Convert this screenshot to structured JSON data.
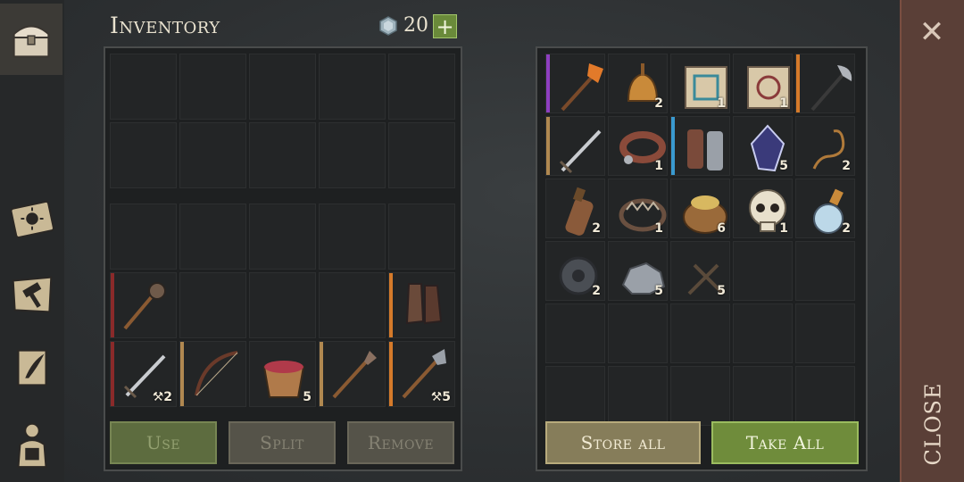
{
  "inventory": {
    "title": "Inventory",
    "gems": "20",
    "add_symbol": "+"
  },
  "inventory_slots": [
    {
      "icon": "mace-icon",
      "qty": "",
      "bar": "#8a2a2a"
    },
    {
      "icon": "",
      "qty": "",
      "bar": ""
    },
    {
      "icon": "",
      "qty": "",
      "bar": ""
    },
    {
      "icon": "",
      "qty": "",
      "bar": ""
    },
    {
      "icon": "boots-icon",
      "qty": "",
      "bar": "#d57a2a"
    },
    {
      "icon": "sword-icon",
      "qty": "2",
      "bar": "#8a2a2a",
      "tool": true
    },
    {
      "icon": "bow-icon",
      "qty": "",
      "bar": "#b08850"
    },
    {
      "icon": "berry-bowl-icon",
      "qty": "5",
      "bar": ""
    },
    {
      "icon": "spear-icon",
      "qty": "",
      "bar": "#b08850"
    },
    {
      "icon": "halberd-icon",
      "qty": "5",
      "bar": "#d57a2a",
      "tool": true
    }
  ],
  "actions": {
    "use": "Use",
    "split": "Split",
    "remove": "Remove"
  },
  "storage_slots": [
    {
      "icon": "fire-axe-icon",
      "qty": "",
      "bar": "#8e3fc0"
    },
    {
      "icon": "bell-icon",
      "qty": "2",
      "bar": ""
    },
    {
      "icon": "scroll-blue-icon",
      "qty": "1",
      "bar": ""
    },
    {
      "icon": "scroll-red-icon",
      "qty": "1",
      "bar": ""
    },
    {
      "icon": "battle-axe-icon",
      "qty": "",
      "bar": "#d57a2a"
    },
    {
      "icon": "sword-icon",
      "qty": "",
      "bar": "#b08850"
    },
    {
      "icon": "collar-icon",
      "qty": "1",
      "bar": ""
    },
    {
      "icon": "gauntlets-icon",
      "qty": "",
      "bar": "#3a9ad0"
    },
    {
      "icon": "crystal-icon",
      "qty": "5",
      "bar": ""
    },
    {
      "icon": "rope-icon",
      "qty": "2",
      "bar": ""
    },
    {
      "icon": "bottle-icon",
      "qty": "2",
      "bar": ""
    },
    {
      "icon": "bear-trap-icon",
      "qty": "1",
      "bar": ""
    },
    {
      "icon": "sack-icon",
      "qty": "6",
      "bar": ""
    },
    {
      "icon": "skull-icon",
      "qty": "1",
      "bar": ""
    },
    {
      "icon": "potion-icon",
      "qty": "2",
      "bar": ""
    },
    {
      "icon": "gear-part-icon",
      "qty": "2",
      "bar": ""
    },
    {
      "icon": "stone-icon",
      "qty": "5",
      "bar": ""
    },
    {
      "icon": "nails-icon",
      "qty": "5",
      "bar": ""
    }
  ],
  "storage": {
    "store_all": "Store all",
    "take_all": "Take All"
  },
  "close": {
    "label": "CLOSE",
    "x_symbol": "✕"
  }
}
